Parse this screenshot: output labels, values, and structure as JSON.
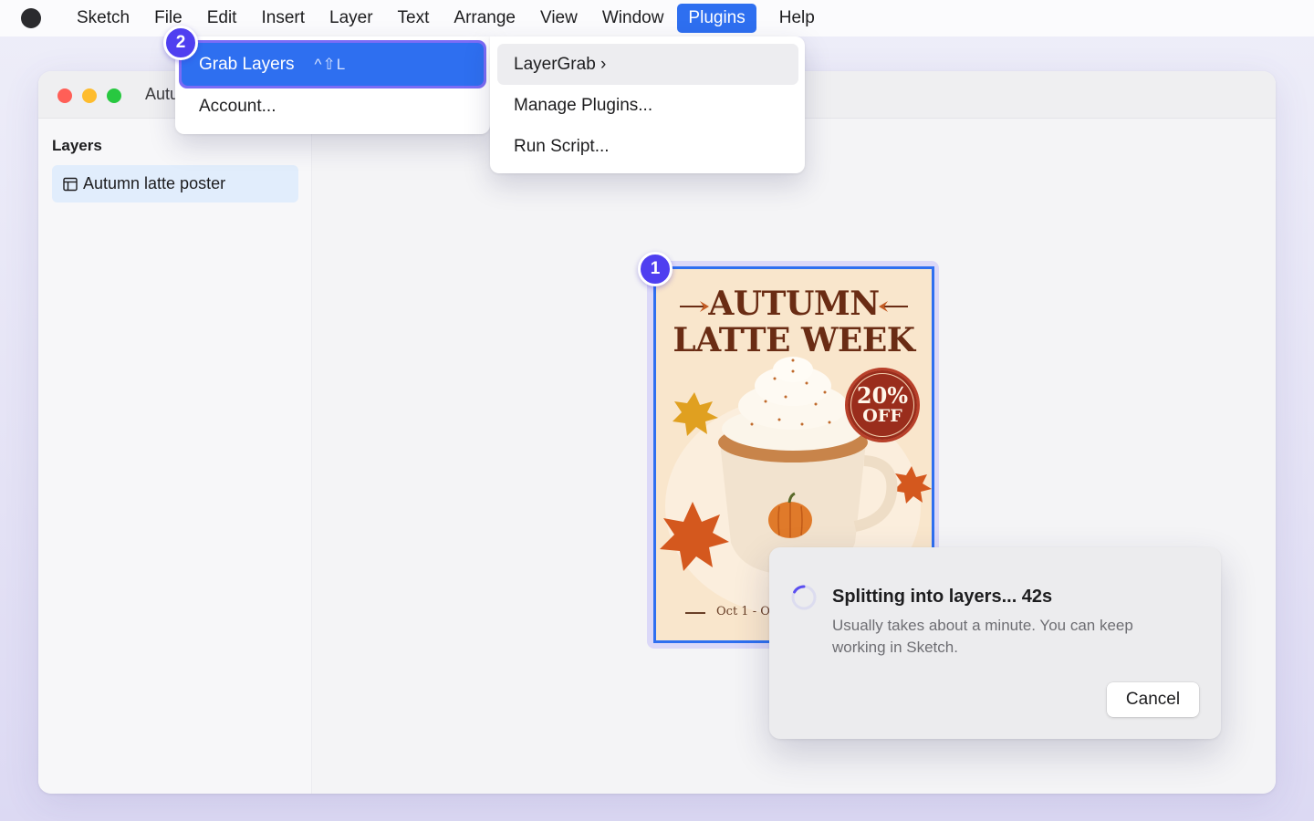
{
  "menubar": {
    "app_name": "Sketch",
    "items": [
      "File",
      "Edit",
      "Insert",
      "Layer",
      "Text",
      "Arrange",
      "View",
      "Window",
      "Plugins",
      "Help"
    ],
    "active_item": "Plugins"
  },
  "window": {
    "title_visible": "Autu",
    "sidebar_heading": "Layers",
    "layers": [
      {
        "label": "Autumn latte poster",
        "icon": "artboard-icon",
        "selected": true
      }
    ]
  },
  "poster": {
    "title_line1": "AUTUMN",
    "title_line2": "LATTE WEEK",
    "badge_line1": "20%",
    "badge_line2": "OFF",
    "date_visible": "Oct 1 - Oct",
    "colors": {
      "background": "#f9e6cc",
      "title": "#6a2c14",
      "badge": "#9a2d1c",
      "leaf": "#d4581e",
      "cup": "#f2e3cf"
    }
  },
  "steps": {
    "canvas": "1",
    "menu": "2"
  },
  "plugins_menu": {
    "grab_layers_label": "Grab Layers",
    "grab_layers_shortcut": "^⇧L",
    "account_label": "Account..."
  },
  "plugins_submenu": {
    "items": [
      "LayerGrab ›",
      "Manage Plugins...",
      "Run Script..."
    ],
    "highlighted": "LayerGrab ›"
  },
  "dialog": {
    "title": "Splitting into layers... 42s",
    "body": "Usually takes about a minute. You can keep working in Sketch.",
    "cancel_label": "Cancel"
  },
  "accent_colors": {
    "selection_blue": "#2e6ff0",
    "step_purple": "#4f3ff0"
  }
}
